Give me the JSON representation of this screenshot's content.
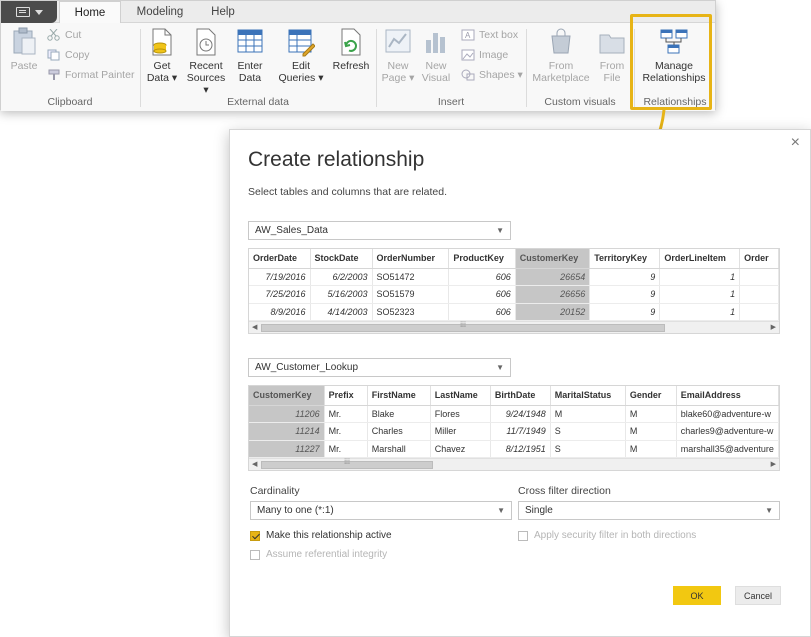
{
  "ribbon": {
    "tabs": [
      "Home",
      "Modeling",
      "Help"
    ],
    "clipboard": {
      "paste": "Paste",
      "cut": "Cut",
      "copy": "Copy",
      "format_painter": "Format Painter",
      "label": "Clipboard"
    },
    "external_data": {
      "get_data": [
        "Get",
        "Data ▾"
      ],
      "recent_sources": [
        "Recent",
        "Sources ▾"
      ],
      "enter_data": [
        "Enter",
        "Data"
      ],
      "edit_queries": [
        "Edit",
        "Queries ▾"
      ],
      "refresh": "Refresh",
      "label": "External data"
    },
    "insert": {
      "new_page": [
        "New",
        "Page ▾"
      ],
      "new_visual": [
        "New",
        "Visual"
      ],
      "text_box": "Text box",
      "image": "Image",
      "shapes": "Shapes ▾",
      "label": "Insert"
    },
    "custom_visuals": {
      "from_marketplace": [
        "From",
        "Marketplace"
      ],
      "from_file": [
        "From",
        "File"
      ],
      "label": "Custom visuals"
    },
    "relationships": {
      "manage": [
        "Manage",
        "Relationships"
      ],
      "label": "Relationships"
    },
    "highlight_color": "#e7b416"
  },
  "dialog": {
    "title": "Create relationship",
    "subtitle": "Select tables and columns that are related.",
    "close": "×",
    "table1": {
      "name": "AW_Sales_Data",
      "columns": [
        "OrderDate",
        "StockDate",
        "OrderNumber",
        "ProductKey",
        "CustomerKey",
        "TerritoryKey",
        "OrderLineItem",
        "Order"
      ],
      "rows": [
        [
          "7/19/2016",
          "6/2/2003",
          "SO51472",
          "606",
          "26654",
          "9",
          "1",
          ""
        ],
        [
          "7/25/2016",
          "5/16/2003",
          "SO51579",
          "606",
          "26656",
          "9",
          "1",
          ""
        ],
        [
          "8/9/2016",
          "4/14/2003",
          "SO52323",
          "606",
          "20152",
          "9",
          "1",
          ""
        ]
      ],
      "selected_column": "CustomerKey"
    },
    "table2": {
      "name": "AW_Customer_Lookup",
      "columns": [
        "CustomerKey",
        "Prefix",
        "FirstName",
        "LastName",
        "BirthDate",
        "MaritalStatus",
        "Gender",
        "EmailAddress"
      ],
      "rows": [
        [
          "11206",
          "Mr.",
          "Blake",
          "Flores",
          "9/24/1948",
          "M",
          "M",
          "blake60@adventure-w"
        ],
        [
          "11214",
          "Mr.",
          "Charles",
          "Miller",
          "11/7/1949",
          "S",
          "M",
          "charles9@adventure-w"
        ],
        [
          "11227",
          "Mr.",
          "Marshall",
          "Chavez",
          "8/12/1951",
          "S",
          "M",
          "marshall35@adventure"
        ]
      ],
      "selected_column": "CustomerKey"
    },
    "cardinality_label": "Cardinality",
    "cardinality_value": "Many to one (*:1)",
    "cross_filter_label": "Cross filter direction",
    "cross_filter_value": "Single",
    "active_checkbox": "Make this relationship active",
    "referential_checkbox": "Assume referential integrity",
    "security_checkbox": "Apply security filter in both directions",
    "ok": "OK",
    "cancel": "Cancel",
    "accent_color": "#f2c811"
  }
}
